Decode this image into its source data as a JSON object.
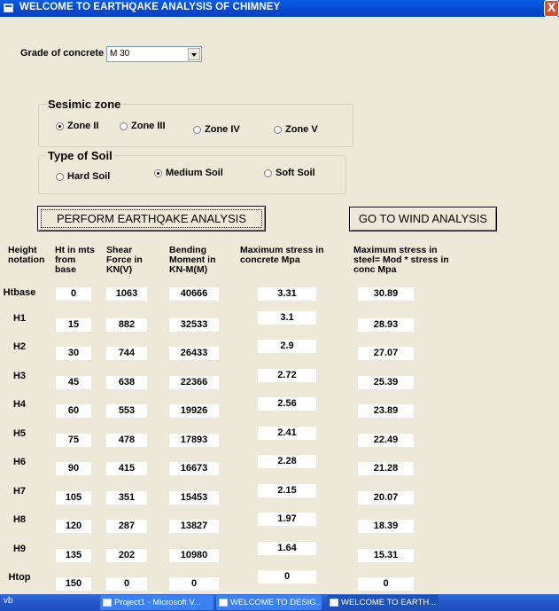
{
  "window": {
    "title": "WELCOME TO EARTHQAKE ANALYSIS OF CHIMNEY",
    "close": "X"
  },
  "grade": {
    "label": "Grade of concrete",
    "value": "M 30"
  },
  "seismic": {
    "title": "Sesimic zone",
    "options": [
      "Zone II",
      "Zone III",
      "Zone IV",
      "Zone V"
    ],
    "selected": "Zone II"
  },
  "soil": {
    "title": "Type of Soil",
    "options": [
      "Hard Soil",
      "Medium Soil",
      "Soft Soil"
    ],
    "selected": "Medium Soil"
  },
  "buttons": {
    "perform": "PERFORM  EARTHQAKE ANALYSIS",
    "wind": "GO TO WIND ANALYSIS"
  },
  "table": {
    "headers": {
      "height": "Height notation",
      "ht": "Ht in mts from base",
      "shear": "Shear Force in KN(V)",
      "moment": "Bending Moment in KN-M(M)",
      "concrete": "Maximum stress in concrete Mpa",
      "steel": "Maximum stress in steel= Mod * stress in conc Mpa"
    },
    "rows": [
      {
        "label": "Htbase",
        "ht": "0",
        "shear": "1063",
        "moment": "40666",
        "concrete": "3.31",
        "steel": "30.89"
      },
      {
        "label": "H1",
        "ht": "15",
        "shear": "882",
        "moment": "32533",
        "concrete": "3.1",
        "steel": "28.93"
      },
      {
        "label": "H2",
        "ht": "30",
        "shear": "744",
        "moment": "26433",
        "concrete": "2.9",
        "steel": "27.07"
      },
      {
        "label": "H3",
        "ht": "45",
        "shear": "638",
        "moment": "22366",
        "concrete": "2.72",
        "steel": "25.39"
      },
      {
        "label": "H4",
        "ht": "60",
        "shear": "553",
        "moment": "19926",
        "concrete": "2.56",
        "steel": "23.89"
      },
      {
        "label": "H5",
        "ht": "75",
        "shear": "478",
        "moment": "17893",
        "concrete": "2.41",
        "steel": "22.49"
      },
      {
        "label": "H6",
        "ht": "90",
        "shear": "415",
        "moment": "16673",
        "concrete": "2.28",
        "steel": "21.28"
      },
      {
        "label": "H7",
        "ht": "105",
        "shear": "351",
        "moment": "15453",
        "concrete": "2.15",
        "steel": "20.07"
      },
      {
        "label": "H8",
        "ht": "120",
        "shear": "287",
        "moment": "13827",
        "concrete": "1.97",
        "steel": "18.39"
      },
      {
        "label": "H9",
        "ht": "135",
        "shear": "202",
        "moment": "10980",
        "concrete": "1.64",
        "steel": "15.31"
      },
      {
        "label": "Htop",
        "ht": "150",
        "shear": "0",
        "moment": "0",
        "concrete": "0",
        "steel": "0"
      }
    ]
  },
  "taskbar": {
    "start": "vb",
    "tasks": [
      "Project1 - Microsoft V...",
      "WELCOME TO DESIG...",
      "WELCOME TO EARTH..."
    ]
  }
}
